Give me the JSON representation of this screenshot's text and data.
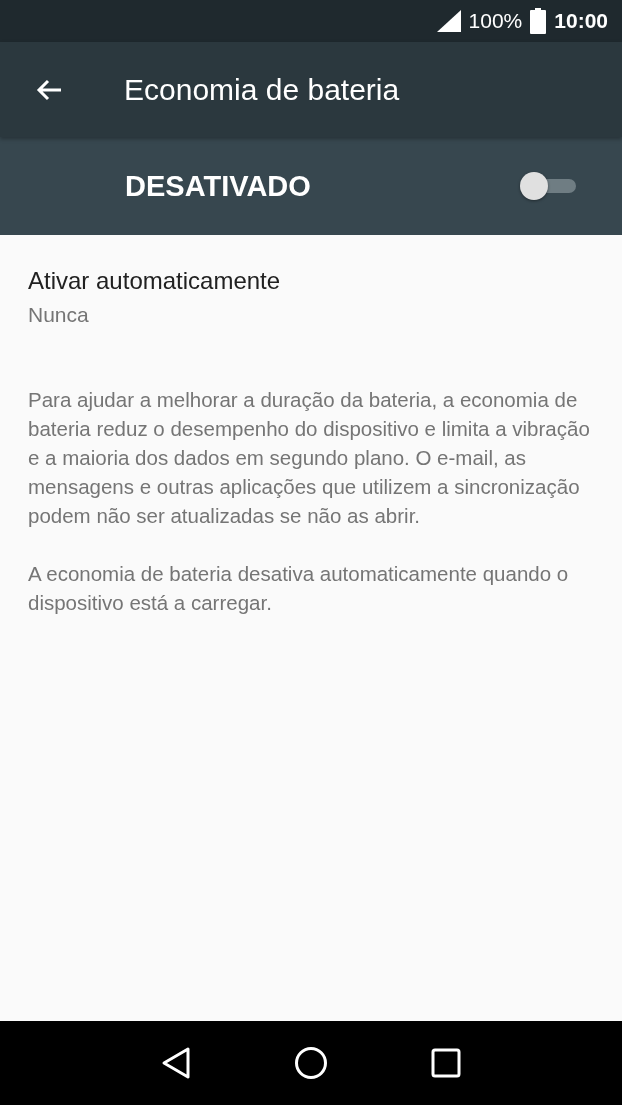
{
  "status_bar": {
    "battery": "100%",
    "time": "10:00"
  },
  "toolbar": {
    "title": "Economia de bateria"
  },
  "master_switch": {
    "label": "DESATIVADO",
    "on": false
  },
  "settings": [
    {
      "title": "Ativar automaticamente",
      "summary": "Nunca"
    }
  ],
  "paragraphs": [
    "Para ajudar a melhorar a duração da bateria, a economia de bateria reduz o desempenho do dispositivo e limita a vibração e a maioria dos dados em segundo plano. O e-mail, as mensagens e outras aplicações que utilizem a sincronização podem não ser atualizadas se não as abrir.",
    "A economia de bateria desativa automaticamente quando o dispositivo está a carregar."
  ]
}
